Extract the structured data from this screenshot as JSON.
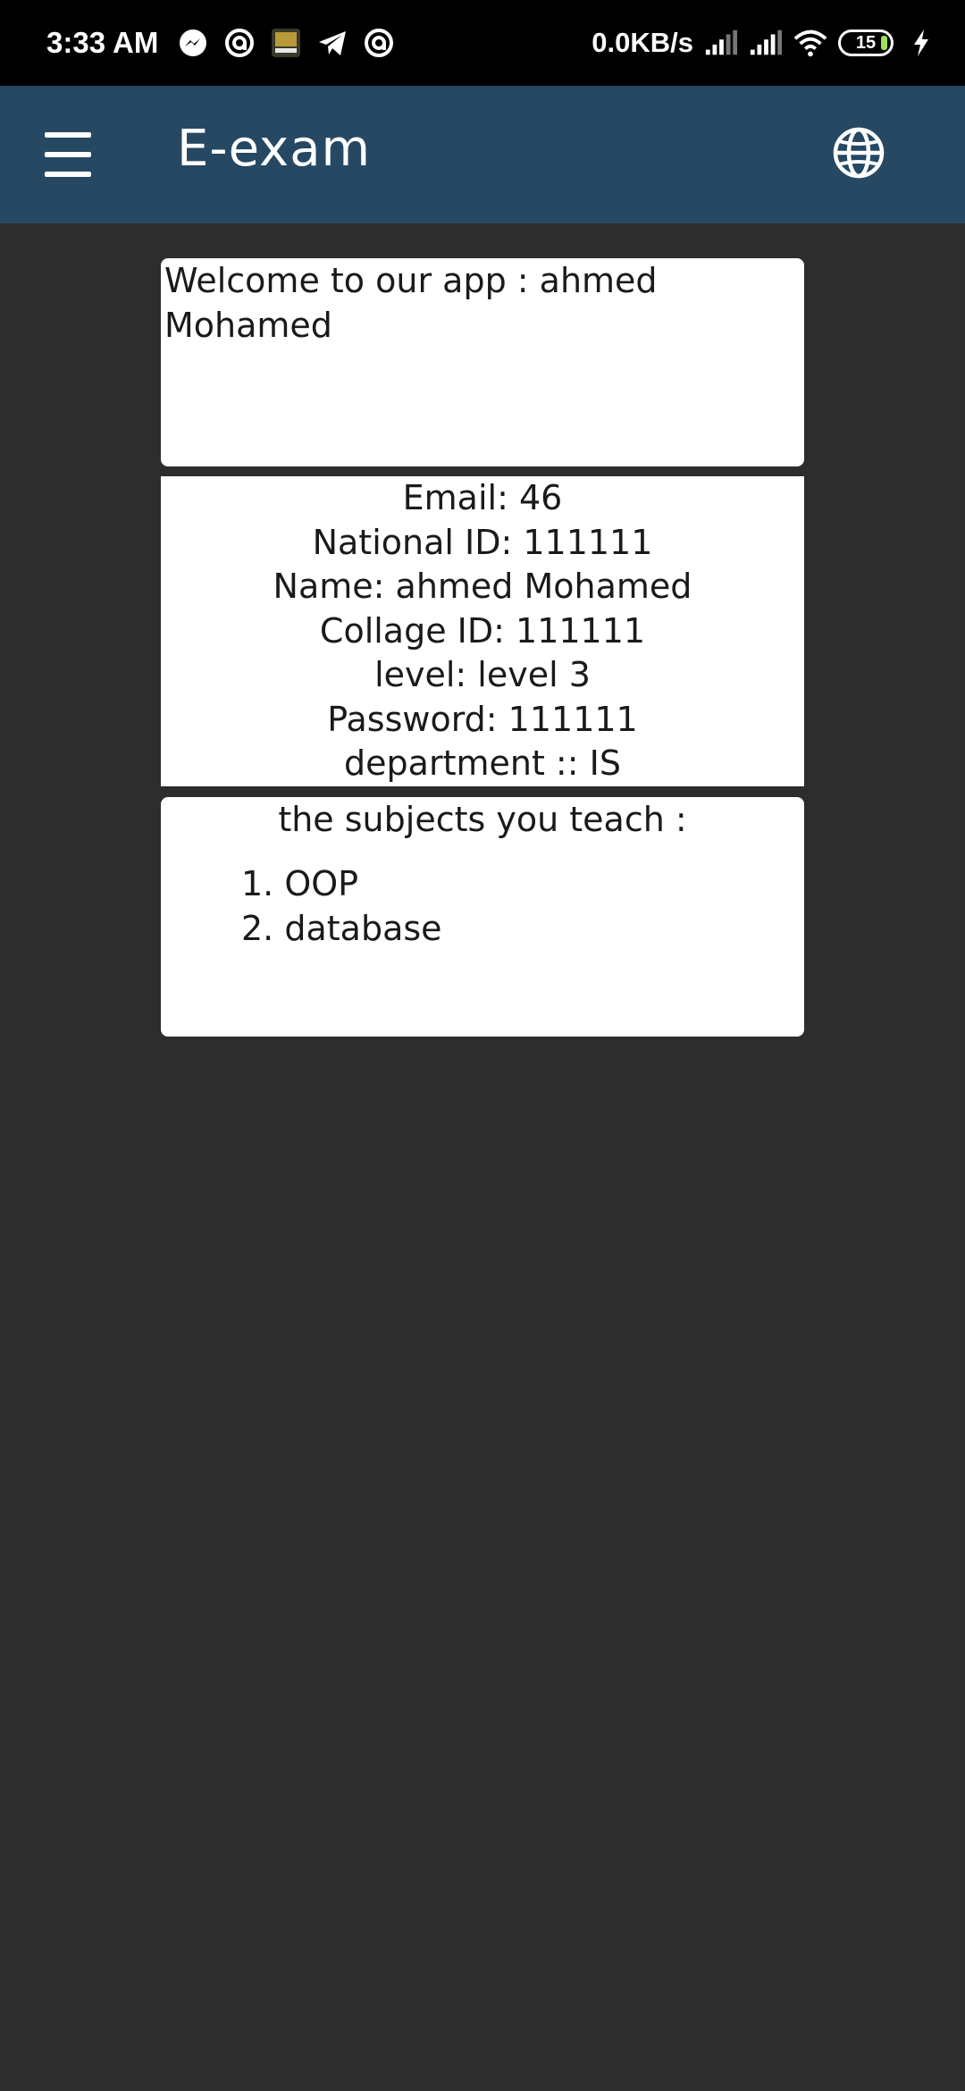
{
  "status_bar": {
    "time": "3:33 AM",
    "net_speed": "0.0KB/s",
    "battery_level": "15",
    "notification_icons": [
      "messenger-icon",
      "at-sign-icon",
      "call-of-duty-icon",
      "telegram-icon",
      "at-sign-icon"
    ],
    "colors": {
      "background": "#000000",
      "text": "#ffffff",
      "battery_fill": "#9be15d"
    }
  },
  "app_bar": {
    "title": "E-exam",
    "menu_icon": "hamburger-menu-icon",
    "language_icon": "globe-icon",
    "background": "#264863"
  },
  "welcome": {
    "text": "Welcome to our app : ahmed Mohamed"
  },
  "profile": {
    "email": "Email: 46",
    "national_id": "National ID: 111111",
    "name": "Name: ahmed Mohamed",
    "collage_id": "Collage ID: 111111",
    "level": "level: level 3",
    "password": "Password: 111111",
    "department": "department :: IS"
  },
  "subjects": {
    "heading": "the subjects you teach :",
    "items": [
      {
        "number": "1.",
        "name": "OOP"
      },
      {
        "number": "2.",
        "name": "database"
      }
    ]
  },
  "colors": {
    "page_background": "#2d2d2d",
    "card_background": "#ffffff"
  }
}
